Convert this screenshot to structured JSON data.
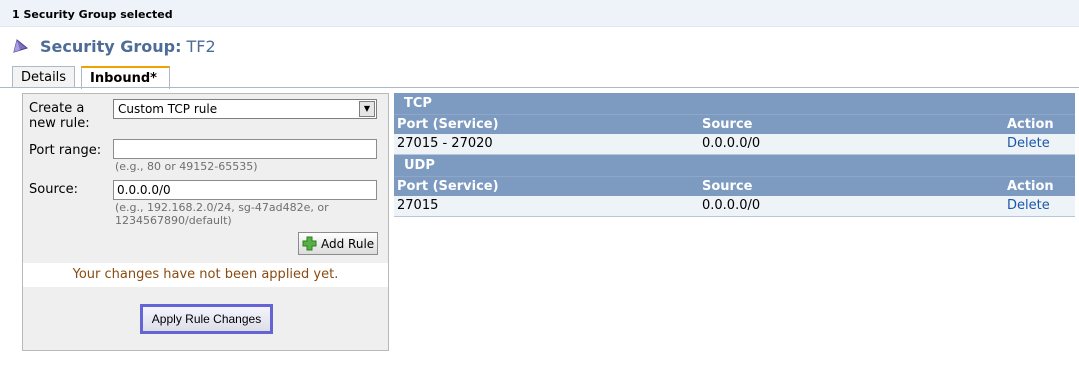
{
  "selection_bar": {
    "text": "1 Security Group selected"
  },
  "header": {
    "label": "Security Group:",
    "value": "TF2"
  },
  "tabs": [
    {
      "label": "Details"
    },
    {
      "label": "Inbound*"
    }
  ],
  "form": {
    "create_rule_label": "Create a new rule:",
    "rule_type_selected": "Custom TCP rule",
    "port_range_label": "Port range:",
    "port_range_value": "",
    "port_range_hint": "(e.g., 80 or 49152-65535)",
    "source_label": "Source:",
    "source_value": "0.0.0.0/0",
    "source_hint_1": "(e.g., 192.168.2.0/24, sg-47ad482e, or",
    "source_hint_2": "1234567890/default)",
    "add_rule_label": "Add Rule",
    "warning": "Your changes have not been applied yet.",
    "apply_label": "Apply Rule Changes"
  },
  "rules": {
    "columns": {
      "port": "Port (Service)",
      "source": "Source",
      "action": "Action"
    },
    "groups": [
      {
        "protocol": "TCP",
        "rows": [
          {
            "port": "27015 - 27020",
            "source": "0.0.0.0/0",
            "action": "Delete"
          }
        ]
      },
      {
        "protocol": "UDP",
        "rows": [
          {
            "port": "27015",
            "source": "0.0.0.0/0",
            "action": "Delete"
          }
        ]
      }
    ]
  },
  "colors": {
    "accent": "#4d6c97",
    "table_header": "#7d9ac0",
    "tab_active": "#f0a000",
    "apply_border": "#6464d4"
  },
  "icons": {
    "title": "security-group-icon",
    "add": "plus-icon",
    "select": "chevron-down-icon"
  }
}
